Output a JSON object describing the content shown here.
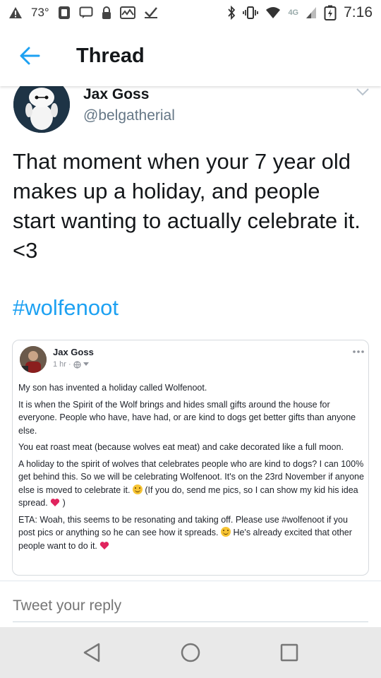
{
  "status_bar": {
    "temperature": "73°",
    "network": "4G",
    "time": "7:16"
  },
  "app_bar": {
    "title": "Thread"
  },
  "tweet": {
    "author_name": "Jax Goss",
    "author_handle": "@belgatherial",
    "text": "That moment when your 7 year old makes up a holiday, and people start wanting to actually celebrate it. <3",
    "hashtag": "#wolfenoot"
  },
  "embedded_post": {
    "author_name": "Jax Goss",
    "time": "1 hr ·",
    "paragraphs": {
      "p1": "My son has invented a holiday called Wolfenoot.",
      "p2": "It is when the Spirit of the Wolf brings and hides small gifts around the house for everyone. People who have, have had, or are kind to dogs get better gifts than anyone else.",
      "p3": "You eat roast meat (because wolves eat meat) and cake decorated like a full moon.",
      "p4a": "A holiday to the spirit of wolves that celebrates people who are kind to dogs? I can 100% get behind this. So we will be celebrating Wolfenoot. It's on the 23rd November if anyone else is moved to celebrate it.",
      "p4b": "(If you do, send me pics, so I can show my kid his idea spread.",
      "p4c": ")",
      "p5a": "ETA: Woah, this seems to be resonating and taking off. Please use #wolfenoot if you post pics or anything so he can see how it spreads.",
      "p5b": "He's already excited that other people want to do it."
    }
  },
  "reply": {
    "placeholder": "Tweet your reply"
  },
  "colors": {
    "accent": "#1da1f2",
    "heart": "#e0245e",
    "smile": "#f7c433"
  },
  "icons": [
    "back-arrow-icon",
    "caret-down-icon",
    "more-dots-icon",
    "globe-icon",
    "smile-emoji-icon",
    "heart-emoji-icon",
    "nav-back-icon",
    "nav-home-icon",
    "nav-recents-icon"
  ]
}
